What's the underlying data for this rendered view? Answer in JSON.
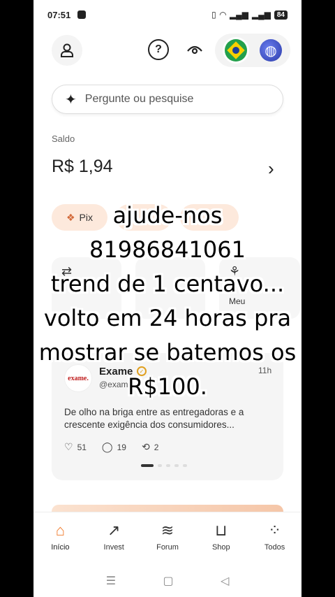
{
  "status_bar": {
    "time": "07:51",
    "battery": "84"
  },
  "header": {
    "icons": [
      "user-icon",
      "help-icon",
      "eye-icon",
      "brazil-flag-icon",
      "globe-icon"
    ]
  },
  "search": {
    "placeholder": "Pergunte ou pesquise"
  },
  "balance": {
    "label": "Saldo",
    "value": "R$ 1,94"
  },
  "quick_actions": [
    {
      "label": "Pix",
      "icon": "pix-icon"
    },
    {
      "label": "",
      "icon": ""
    },
    {
      "label": "",
      "icon": ""
    }
  ],
  "shortcuts": [
    {
      "label": "",
      "icon": "transfer-icon"
    },
    {
      "label": "",
      "icon": ""
    },
    {
      "label": "Meu",
      "icon": "gift-icon"
    }
  ],
  "feed_post": {
    "avatar_text": "exame.",
    "name": "Exame",
    "handle": "@exam",
    "time": "11h",
    "text": "De olho na briga entre as entregadoras e a crescente exigência dos consumidores...",
    "likes": "51",
    "comments": "19",
    "reposts": "2"
  },
  "bottom_nav": [
    {
      "label": "Início",
      "icon": "home-icon",
      "active": true
    },
    {
      "label": "Invest",
      "icon": "chart-icon"
    },
    {
      "label": "Forum",
      "icon": "forum-icon"
    },
    {
      "label": "Shop",
      "icon": "cart-icon"
    },
    {
      "label": "Todos",
      "icon": "grid-icon"
    }
  ],
  "overlay_caption": [
    "ajude-nos",
    "81986841061",
    "trend de 1 centavo...",
    "volto em 24 horas pra",
    "mostrar se batemos os",
    "R$100."
  ],
  "colors": {
    "accent": "#f07a2a",
    "pill_bg": "#fde9dc",
    "card_bg": "#f5f5f5"
  }
}
